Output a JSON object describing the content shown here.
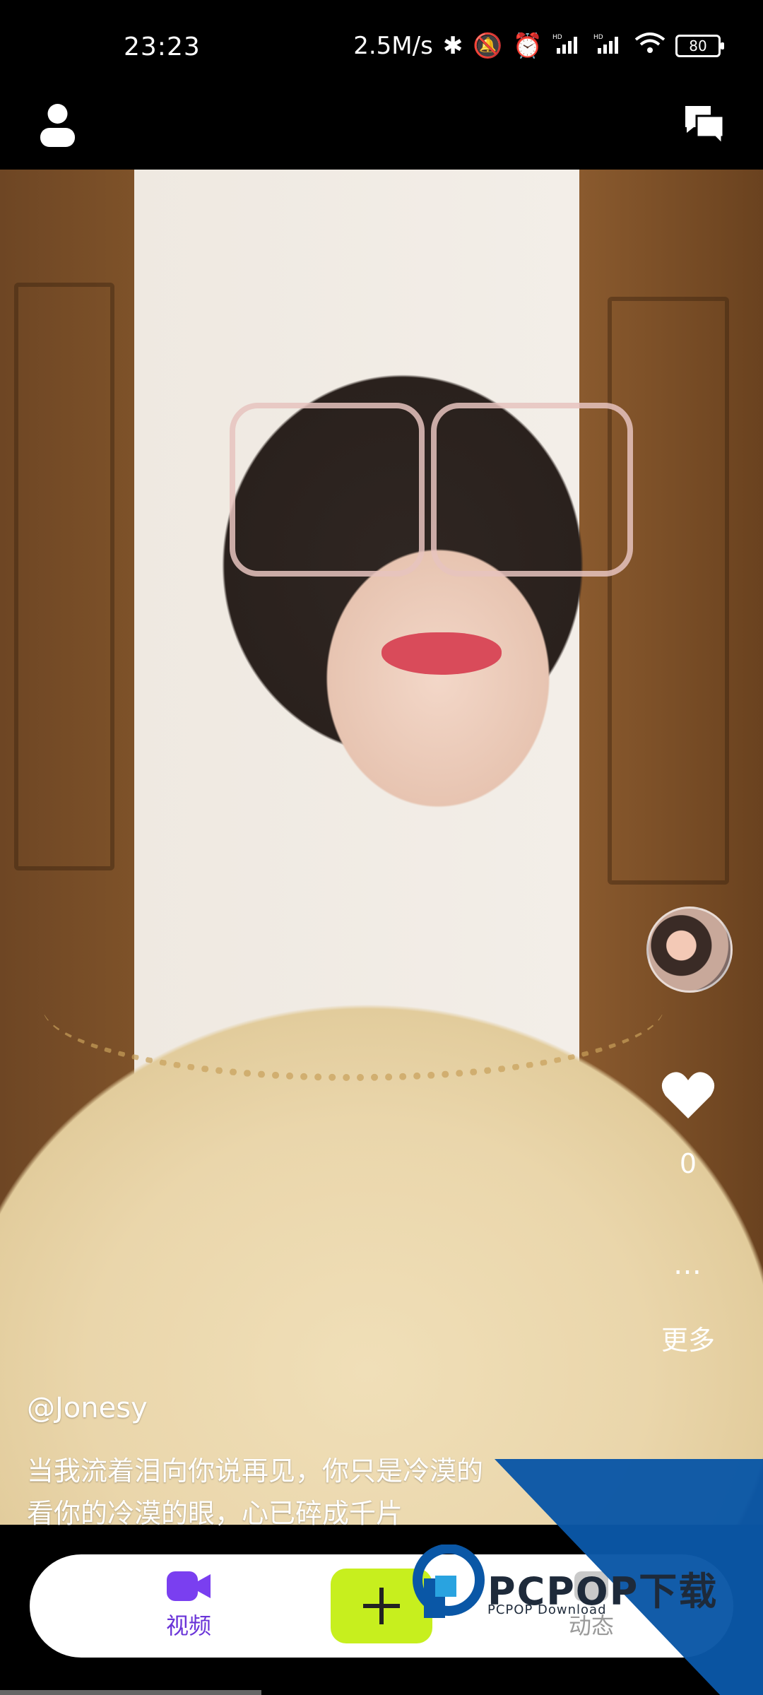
{
  "status_bar": {
    "time": "23:23",
    "net_speed": "2.5M/s",
    "battery": "80",
    "icons": [
      "bluetooth-icon",
      "mute-icon",
      "alarm-icon",
      "hd-signal-icon",
      "hd-signal-icon",
      "wifi-icon",
      "battery-icon"
    ]
  },
  "top_bar": {
    "left_icon": "profile-icon",
    "right_icon": "chat-icon"
  },
  "side_actions": {
    "like_count": "0",
    "more_icon": "…",
    "more_label": "更多"
  },
  "post": {
    "username": "@Jonesy",
    "caption_line1": "当我流着泪向你说再见，你只是冷漠的",
    "caption_line2": "看你的冷漠的眼，心已碎成千片"
  },
  "bottom_nav": {
    "video_label": "视频",
    "add_symbol": "+",
    "dynamic_label": "动态"
  },
  "watermark": {
    "brand": "PCPOP下载",
    "sub": "PCPOP Download"
  },
  "colors": {
    "accent_purple": "#6a34d8",
    "add_button": "#c7ef1e",
    "watermark_blue": "#0a57a6"
  }
}
